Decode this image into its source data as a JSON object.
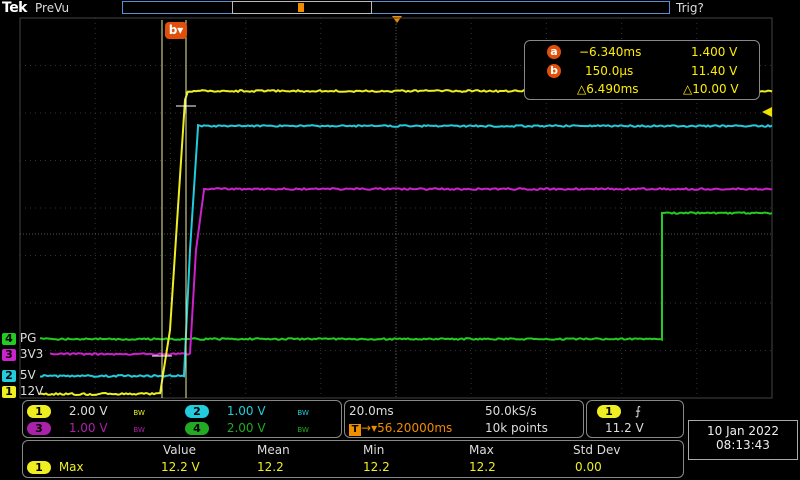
{
  "header": {
    "brand": "Tek",
    "mode": "PreVu",
    "trigger_status": "Trig?"
  },
  "cursor_marker_b": "b",
  "cursor_readout": {
    "a": {
      "badge": "a",
      "time": "−6.340ms",
      "volts": "1.400 V"
    },
    "b": {
      "badge": "b",
      "time": "150.0µs",
      "volts": "11.40 V"
    },
    "delta": {
      "time": "△6.490ms",
      "volts": "△10.00 V"
    }
  },
  "channels": [
    {
      "num": "4",
      "name": "PG",
      "color": "#22cc22"
    },
    {
      "num": "3",
      "name": "3V3",
      "color": "#cc22cc"
    },
    {
      "num": "2",
      "name": "5V",
      "color": "#22ccdd"
    },
    {
      "num": "1",
      "name": "12V",
      "color": "#eeee22"
    }
  ],
  "vertical": [
    {
      "num": "1",
      "scale": "2.00 V",
      "bw": "BW",
      "color": "#eeee22"
    },
    {
      "num": "2",
      "scale": "1.00 V",
      "bw": "BW",
      "color": "#22ccdd"
    },
    {
      "num": "3",
      "scale": "1.00 V",
      "bw": "BW",
      "color": "#cc22cc"
    },
    {
      "num": "4",
      "scale": "2.00 V",
      "bw": "BW",
      "color": "#22cc22"
    }
  ],
  "horizontal": {
    "timebase": "20.0ms",
    "sample_rate": "50.0kS/s",
    "position": "▾56.20000ms",
    "record_length": "10k points",
    "trigger_marker": "T"
  },
  "trigger": {
    "source": "1",
    "slope": "⨍",
    "level": "11.2 V"
  },
  "datetime": {
    "date": "10 Jan  2022",
    "time": "08:13:43"
  },
  "measurements": {
    "headers": [
      "Value",
      "Mean",
      "Min",
      "Max",
      "Std Dev"
    ],
    "row": {
      "source": "1",
      "name": "Max",
      "values": [
        "12.2 V",
        "12.2",
        "12.2",
        "12.2",
        "0.00"
      ]
    }
  },
  "trace_colors": {
    "ch1": "#eeee22",
    "ch2": "#22ccdd",
    "ch3": "#cc22cc",
    "ch4": "#22cc22",
    "cursor": "#f0f0a0",
    "accent": "#e0500a"
  }
}
